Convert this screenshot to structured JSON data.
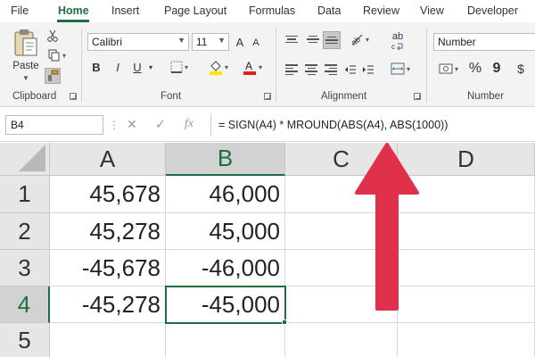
{
  "menu": {
    "tabs": [
      "File",
      "Home",
      "Insert",
      "Page Layout",
      "Formulas",
      "Data",
      "Review",
      "View",
      "Developer"
    ]
  },
  "ribbon": {
    "clipboard": {
      "paste_label": "Paste",
      "group_label": "Clipboard"
    },
    "font": {
      "font_name": "Calibri",
      "font_size": "11",
      "bold": "B",
      "italic": "I",
      "underline": "U",
      "grow": "A",
      "shrink": "A",
      "group_label": "Font"
    },
    "alignment": {
      "wrap_text": "ab",
      "group_label": "Alignment"
    },
    "number": {
      "format": "Number",
      "percent": "%",
      "comma": "9",
      "currency": "$",
      "group_label": "Number"
    }
  },
  "formula_bar": {
    "name_box": "B4",
    "fx": "fx",
    "formula": "= SIGN(A4) * MROUND(ABS(A4), ABS(1000))"
  },
  "sheet": {
    "columns": [
      "A",
      "B",
      "C",
      "D"
    ],
    "rows": [
      "1",
      "2",
      "3",
      "4",
      "5"
    ],
    "active_cell": "B4",
    "cells": {
      "A1": "45,678",
      "B1": "46,000",
      "A2": "45,278",
      "B2": "45,000",
      "A3": "-45,678",
      "B3": "-46,000",
      "A4": "-45,278",
      "B4": "-45,000"
    }
  },
  "colors": {
    "accent": "#1e6f3f",
    "arrow": "#e0314b"
  }
}
